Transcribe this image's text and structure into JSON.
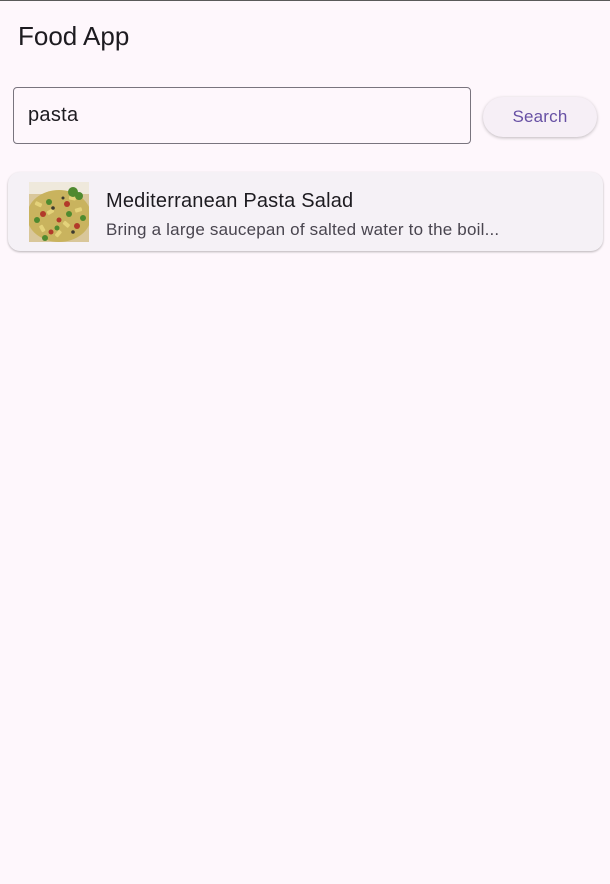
{
  "app": {
    "title": "Food App"
  },
  "search": {
    "value": "pasta",
    "button_label": "Search"
  },
  "results": [
    {
      "title": "Mediterranean Pasta Salad",
      "subtitle": "Bring a large saucepan of salted water to the boil...",
      "image_icon": "pasta-salad-thumbnail"
    }
  ]
}
